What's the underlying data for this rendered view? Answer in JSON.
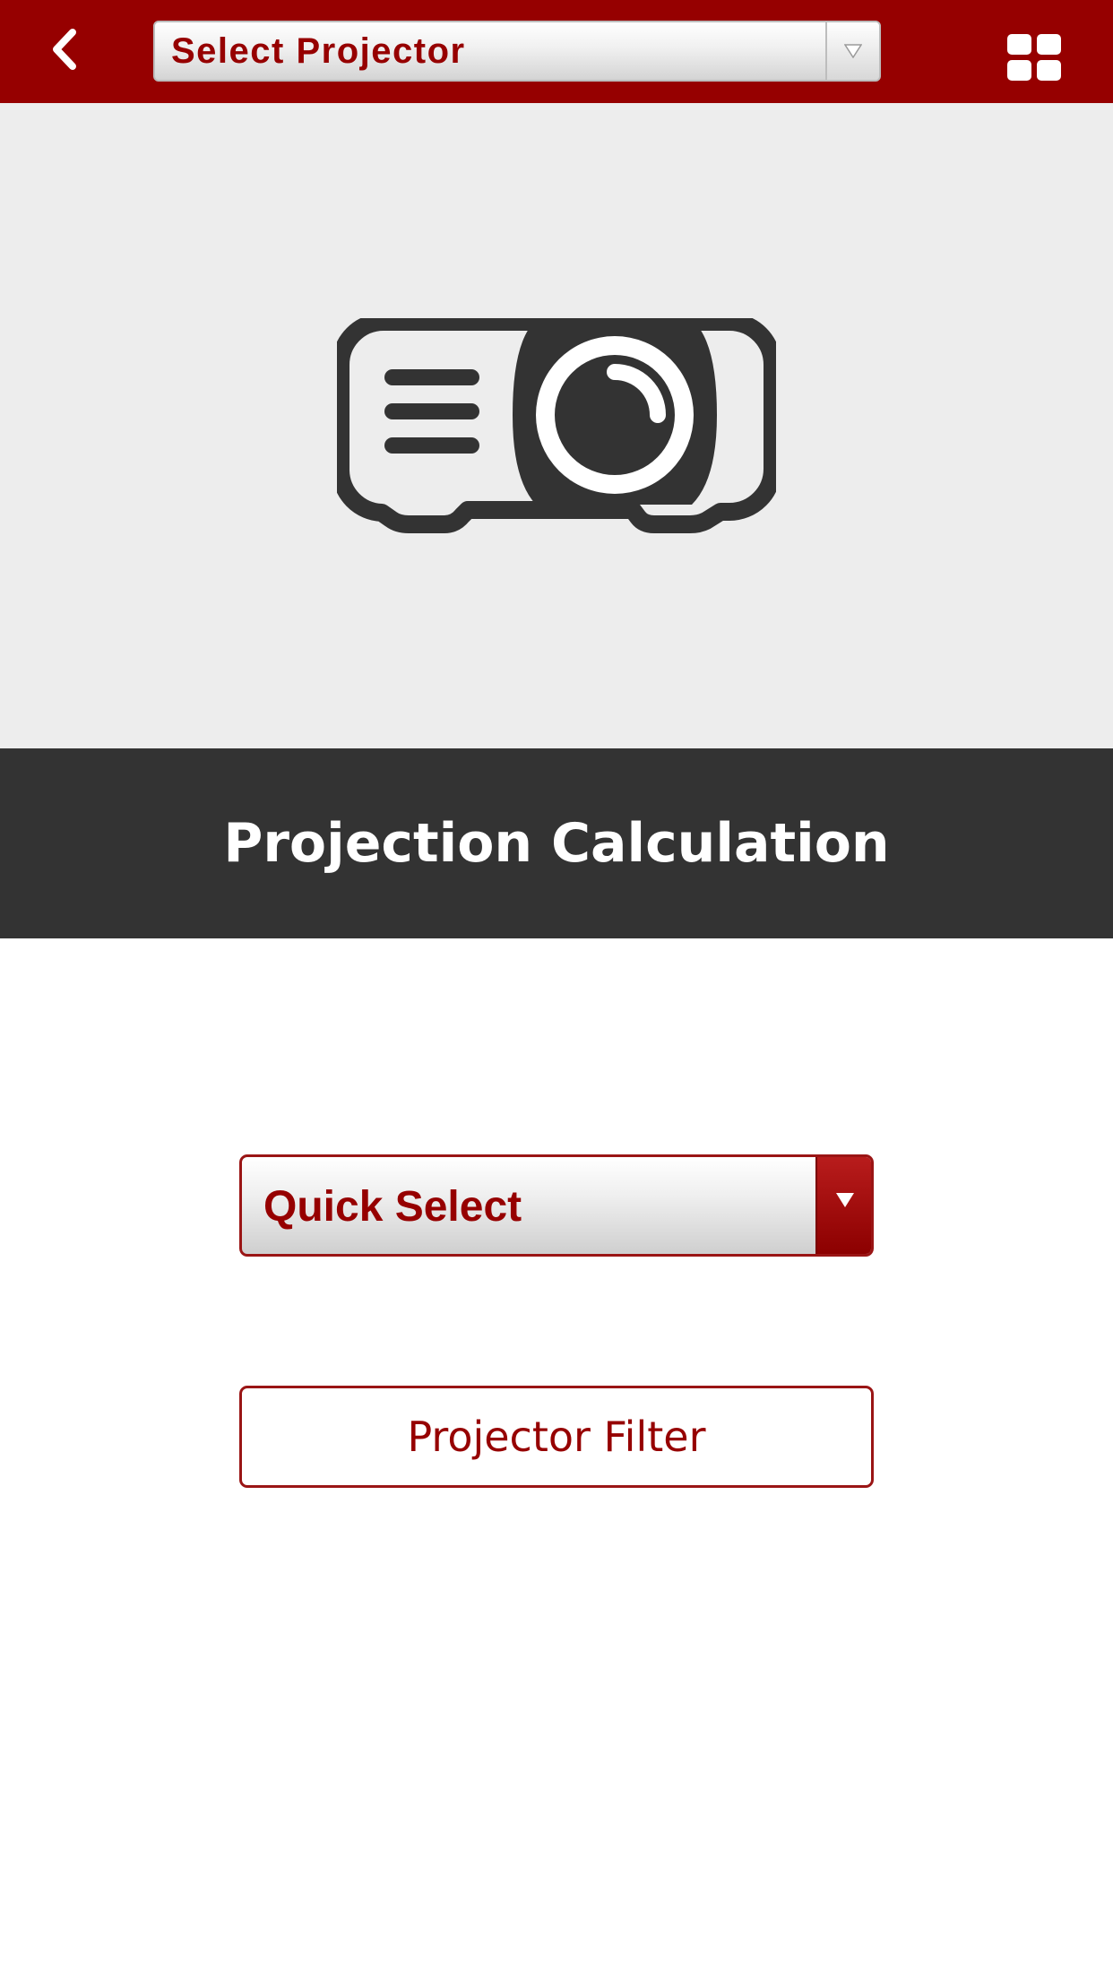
{
  "header": {
    "back_icon": "chevron-left-icon",
    "projector_select_value": "Select Projector",
    "dropdown_icon": "triangle-down-icon",
    "menu_icon": "grid-icon"
  },
  "hero": {
    "icon": "projector-icon"
  },
  "section": {
    "title": "Projection Calculation"
  },
  "main": {
    "quick_select_value": "Quick Select",
    "projector_filter_label": "Projector Filter"
  },
  "colors": {
    "brand_red": "#960000",
    "hero_background": "#ededed",
    "title_band": "#333333",
    "text_on_dark": "#ffffff"
  }
}
